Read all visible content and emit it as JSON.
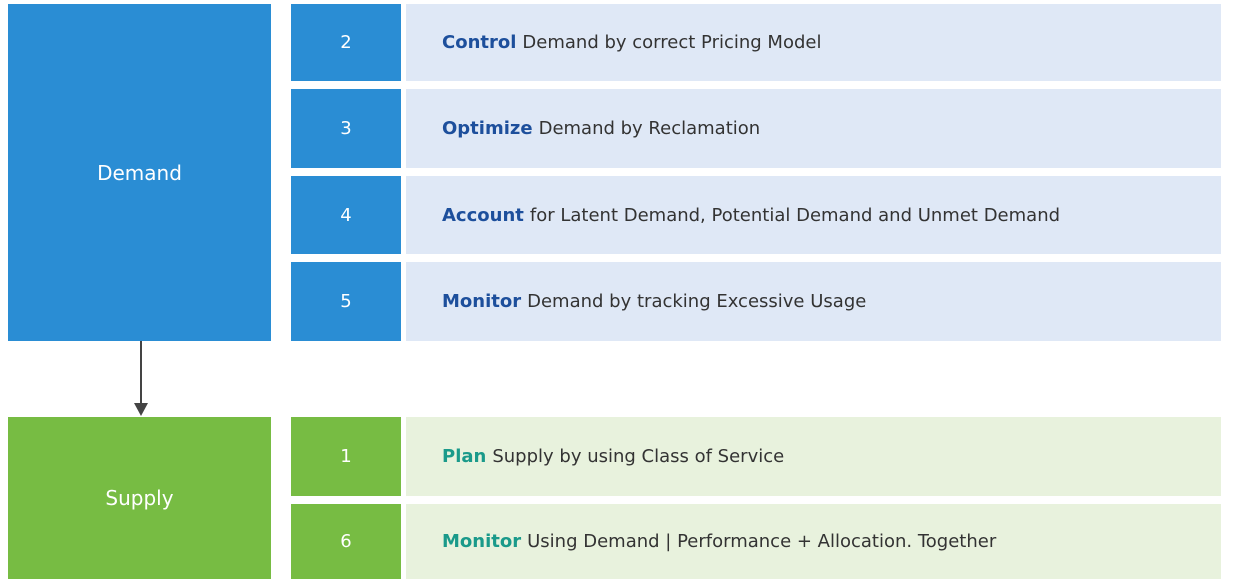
{
  "demand": {
    "label": "Demand",
    "rows": [
      {
        "number": "2",
        "keyword": "Control",
        "text": "Demand by correct Pricing Model"
      },
      {
        "number": "3",
        "keyword": "Optimize",
        "text": "Demand by Reclamation"
      },
      {
        "number": "4",
        "keyword": "Account",
        "text": "for Latent Demand, Potential Demand and Unmet Demand"
      },
      {
        "number": "5",
        "keyword": "Monitor",
        "text": "Demand by tracking Excessive Usage"
      }
    ]
  },
  "supply": {
    "label": "Supply",
    "rows": [
      {
        "number": "1",
        "keyword": "Plan",
        "text": "Supply by using Class of Service"
      },
      {
        "number": "6",
        "keyword": "Monitor",
        "text": "Using Demand | Performance + Allocation. Together"
      }
    ]
  },
  "colors": {
    "demand_accent": "#2a8dd4",
    "demand_row_bg": "#dfe8f6",
    "demand_keyword": "#1d4f9c",
    "supply_accent": "#77bc43",
    "supply_row_bg": "#e8f2dd",
    "supply_keyword": "#1a9a8a"
  }
}
